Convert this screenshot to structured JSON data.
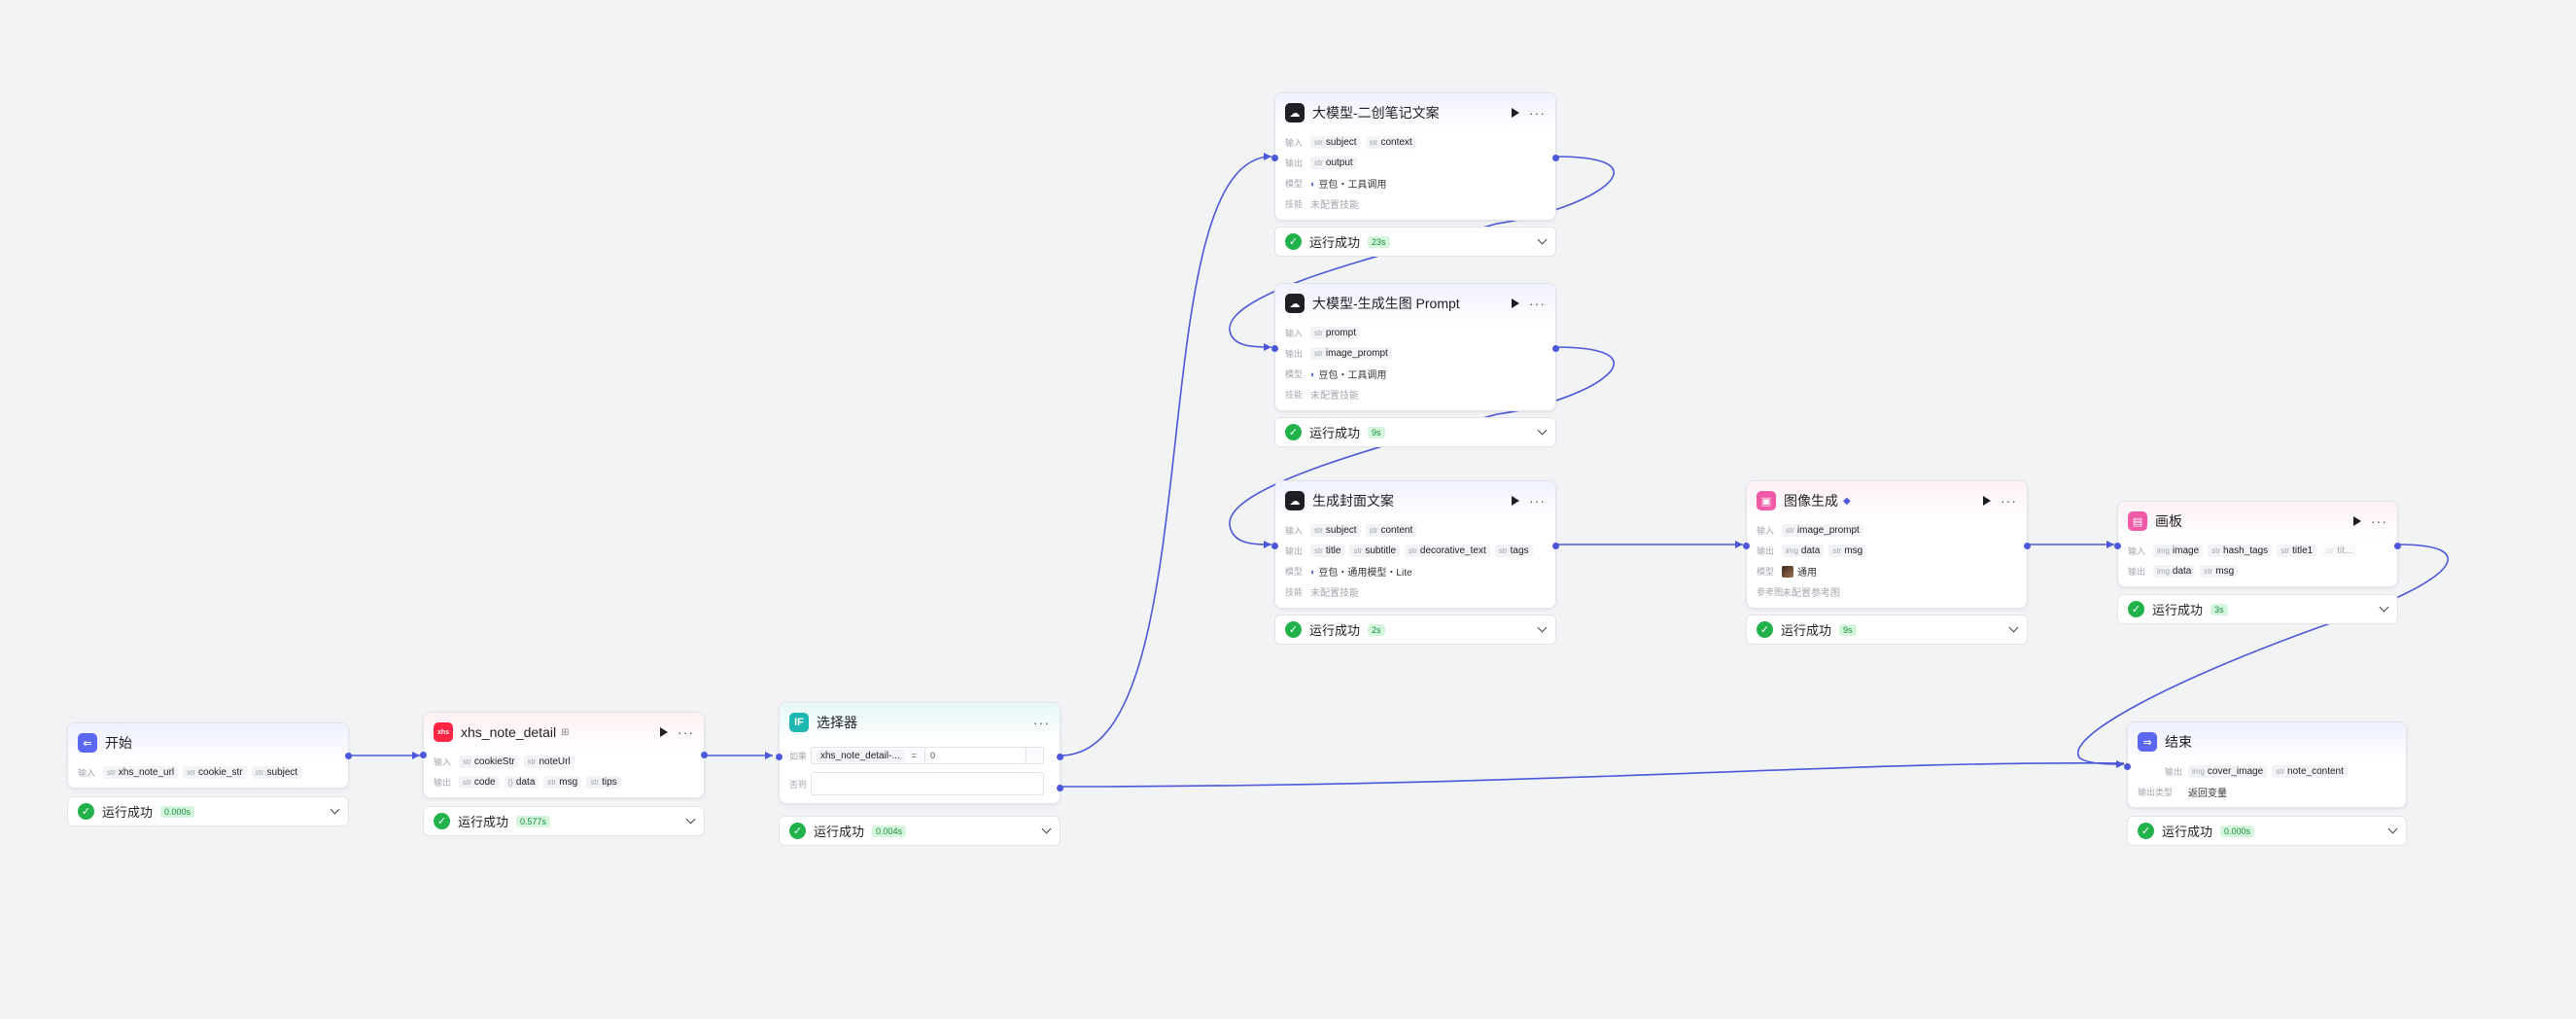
{
  "start": {
    "title": "开始",
    "input_label": "输入",
    "inputs": [
      {
        "type": "str",
        "name": "xhs_note_url"
      },
      {
        "type": "str",
        "name": "cookie_str"
      },
      {
        "type": "str",
        "name": "subject"
      }
    ],
    "status": "运行成功",
    "time": "0.000s"
  },
  "plugin": {
    "title": "xhs_note_detail",
    "icon": "xhs",
    "in_label": "输入",
    "out_label": "输出",
    "inputs": [
      {
        "type": "str",
        "name": "cookieStr"
      },
      {
        "type": "str",
        "name": "noteUrl"
      }
    ],
    "outputs": [
      {
        "type": "str",
        "name": "code"
      },
      {
        "type": "{}",
        "name": "data"
      },
      {
        "type": "str",
        "name": "msg"
      },
      {
        "type": "str",
        "name": "tips"
      }
    ],
    "status": "运行成功",
    "time": "0.577s"
  },
  "selector": {
    "title": "选择器",
    "if_label": "如果",
    "else_label": "否则",
    "cond_left": "xhs_note_detail-...",
    "cond_op": "=",
    "cond_right": "0",
    "status": "运行成功",
    "time": "0.004s"
  },
  "llm1": {
    "title": "大模型-二创笔记文案",
    "in_label": "输入",
    "out_label": "输出",
    "model_label": "模型",
    "skill_label": "技能",
    "inputs": [
      {
        "type": "str",
        "name": "subject"
      },
      {
        "type": "str",
        "name": "context"
      }
    ],
    "outputs": [
      {
        "type": "str",
        "name": "output"
      }
    ],
    "model": "豆包・工具调用",
    "skill": "未配置技能",
    "status": "运行成功",
    "time": "23s"
  },
  "llm2": {
    "title": "大模型-生成生图 Prompt",
    "in_label": "输入",
    "out_label": "输出",
    "model_label": "模型",
    "skill_label": "技能",
    "inputs": [
      {
        "type": "str",
        "name": "prompt"
      }
    ],
    "outputs": [
      {
        "type": "str",
        "name": "image_prompt"
      }
    ],
    "model": "豆包・工具调用",
    "skill": "未配置技能",
    "status": "运行成功",
    "time": "9s"
  },
  "cover": {
    "title": "生成封面文案",
    "in_label": "输入",
    "out_label": "输出",
    "model_label": "模型",
    "skill_label": "技能",
    "inputs": [
      {
        "type": "str",
        "name": "subject"
      },
      {
        "type": "str",
        "name": "content"
      }
    ],
    "outputs": [
      {
        "type": "str",
        "name": "title"
      },
      {
        "type": "str",
        "name": "subtitle"
      },
      {
        "type": "str",
        "name": "decorative_text"
      },
      {
        "type": "str",
        "name": "tags"
      }
    ],
    "model": "豆包・通用模型・Lite",
    "skill": "未配置技能",
    "status": "运行成功",
    "time": "2s"
  },
  "imggen": {
    "title": "图像生成",
    "in_label": "输入",
    "out_label": "输出",
    "model_label": "模型",
    "ref_label": "参考图",
    "inputs": [
      {
        "type": "str",
        "name": "image_prompt"
      }
    ],
    "outputs": [
      {
        "type": "img",
        "name": "data"
      },
      {
        "type": "str",
        "name": "msg"
      }
    ],
    "model": "通用",
    "ref": "未配置参考图",
    "status": "运行成功",
    "time": "9s"
  },
  "board": {
    "title": "画板",
    "in_label": "输入",
    "out_label": "输出",
    "inputs": [
      {
        "type": "img",
        "name": "image"
      },
      {
        "type": "str",
        "name": "hash_tags"
      },
      {
        "type": "str",
        "name": "title1"
      },
      {
        "type": "str",
        "name": "tit..."
      }
    ],
    "outputs": [
      {
        "type": "img",
        "name": "data"
      },
      {
        "type": "str",
        "name": "msg"
      }
    ],
    "status": "运行成功",
    "time": "3s"
  },
  "end": {
    "title": "结束",
    "out_label": "输出",
    "outtype_label": "输出类型",
    "outputs": [
      {
        "type": "img",
        "name": "cover_image"
      },
      {
        "type": "str",
        "name": "note_content"
      }
    ],
    "outtype": "返回变量",
    "status": "运行成功",
    "time": "0.000s"
  },
  "colors": {
    "edge": "#4c58d9",
    "success": "#22b24c",
    "start_icon": "#5b67f0",
    "plugin_icon": "#ff2442",
    "selector_icon": "#1eb7b2",
    "image_icon": "#f05aa6",
    "board_icon": "#f05aa6",
    "end_icon": "#5b67f0"
  }
}
